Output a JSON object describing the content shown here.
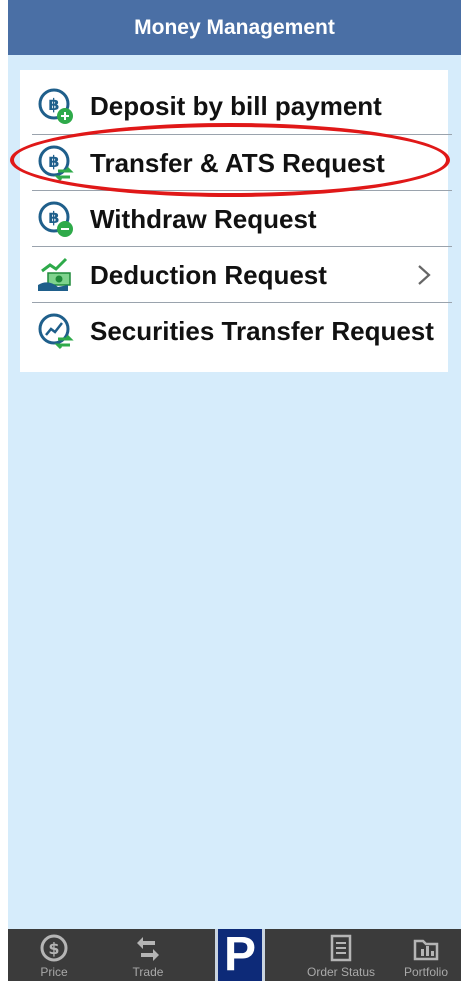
{
  "header": {
    "title": "Money Management"
  },
  "menu": {
    "items": [
      {
        "label": "Deposit by bill payment",
        "icon": "bitcoin-plus-icon"
      },
      {
        "label": "Transfer & ATS Request",
        "icon": "bitcoin-transfer-icon"
      },
      {
        "label": "Withdraw Request",
        "icon": "bitcoin-minus-icon"
      },
      {
        "label": "Deduction Request",
        "icon": "money-hand-chart-icon",
        "has_chevron": true
      },
      {
        "label": "Securities Transfer Request",
        "icon": "chart-transfer-icon"
      }
    ]
  },
  "tabbar": {
    "tabs": [
      {
        "label": "Price",
        "icon": "dollar-coin-icon"
      },
      {
        "label": "Trade",
        "icon": "arrows-icon"
      },
      {
        "label": "P",
        "icon": "p-logo"
      },
      {
        "label": "Order Status",
        "icon": "checklist-icon"
      },
      {
        "label": "Portfolio",
        "icon": "folder-chart-icon"
      }
    ]
  },
  "colors": {
    "header_bg": "#4a6fa5",
    "page_bg": "#d6ecfb",
    "highlight": "#e01818",
    "tabbar_bg": "#3b3b3b",
    "p_logo": "#0d2a78"
  }
}
